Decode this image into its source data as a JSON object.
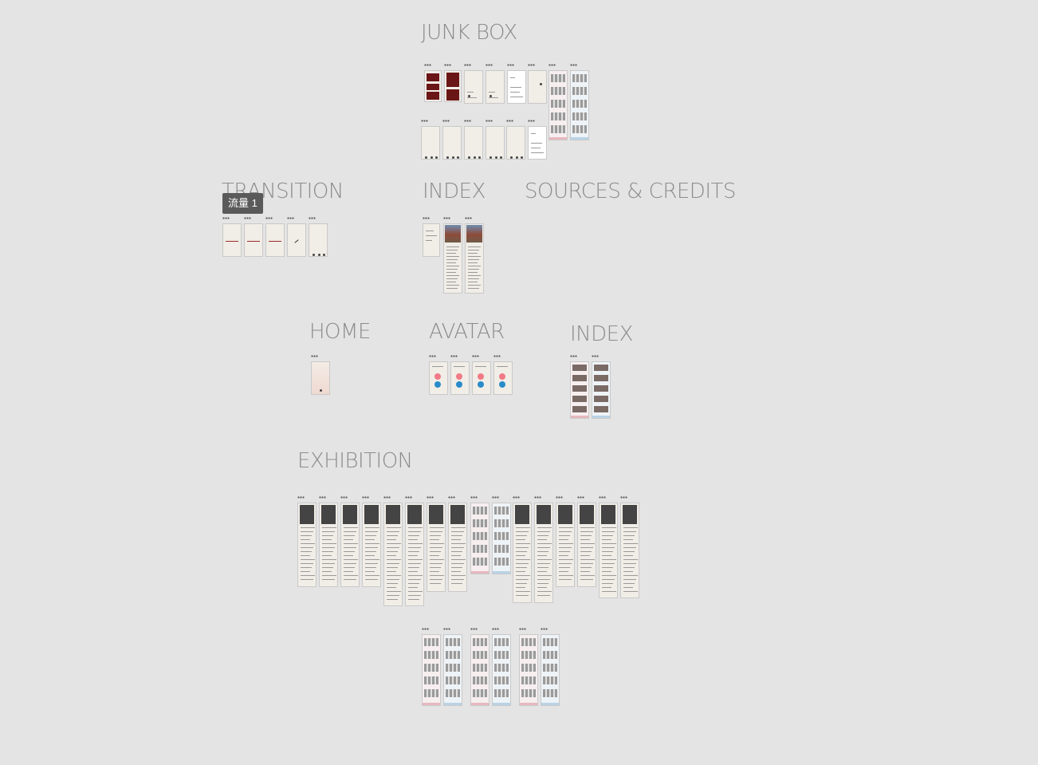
{
  "sections": {
    "junk_box": "JUNK BOX",
    "transition": "TRANSITION",
    "index1": "INDEX",
    "sources": "SOURCES & CREDITS",
    "home": "HOME",
    "avatar": "AVATAR",
    "index2": "INDEX",
    "exhibition": "EXHIBITION"
  },
  "flow_badge": "流量 1",
  "colors": {
    "canvas": "#e4e4e4",
    "title": "#8c8c8c",
    "maroon": "#6a1616",
    "pink": "#f07a86",
    "blue": "#2a8bc9"
  }
}
